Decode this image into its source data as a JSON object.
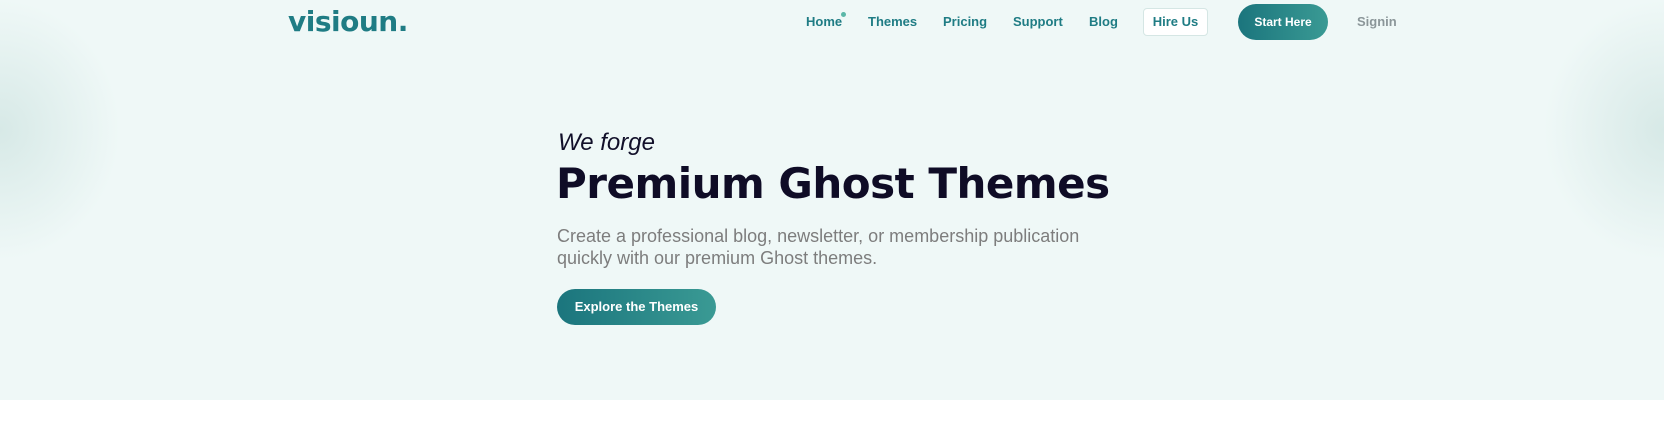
{
  "header": {
    "logo_text": "visioun.",
    "nav": {
      "home": "Home",
      "themes": "Themes",
      "pricing": "Pricing",
      "support": "Support",
      "blog": "Blog",
      "hire_us": "Hire Us",
      "start_here": "Start Here",
      "signin": "Signin"
    }
  },
  "hero": {
    "eyebrow": "We forge",
    "headline": "Premium Ghost Themes",
    "subtitle_line1": "Create a professional blog, newsletter, or membership publication",
    "subtitle_line2": "quickly with our premium Ghost themes.",
    "cta": "Explore the Themes"
  },
  "colors": {
    "brand": "#1f7c84",
    "hero_background": "#eff8f7",
    "headline": "#0f0c26",
    "muted_text": "#7d7d7d",
    "active_dot": "#5bb7a8"
  }
}
